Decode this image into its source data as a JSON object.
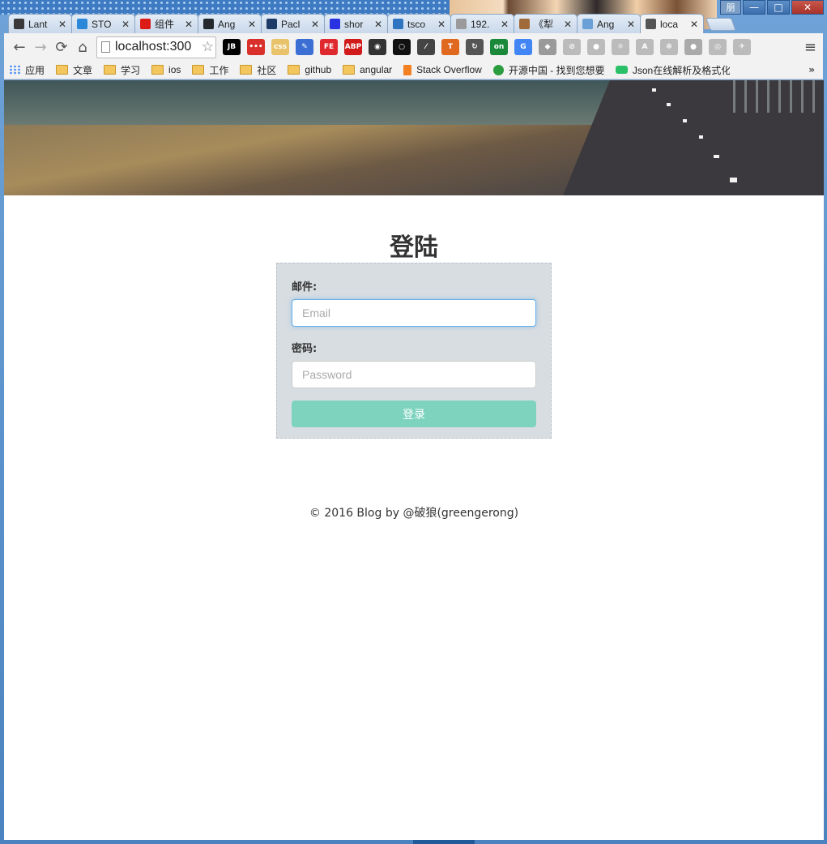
{
  "browser": {
    "window_controls": {
      "user": "朋",
      "minimize": "—",
      "maximize": "□",
      "close": "✕"
    },
    "tabs": [
      {
        "label": "Lant",
        "icon": "arrow-up-icon",
        "color": "#3a3a3a"
      },
      {
        "label": "STO",
        "icon": "globe-icon",
        "color": "#2b88d9"
      },
      {
        "label": "组件",
        "icon": "angular-icon",
        "color": "#dd1b16"
      },
      {
        "label": "Ang",
        "icon": "github-icon",
        "color": "#24292e"
      },
      {
        "label": "Pacl",
        "icon": "n-icon",
        "color": "#1d3b66"
      },
      {
        "label": "shor",
        "icon": "paw-icon",
        "color": "#2932e1"
      },
      {
        "label": "tsco",
        "icon": "ts-icon",
        "color": "#2f74c0"
      },
      {
        "label": "192.",
        "icon": "page-icon",
        "color": "#9a9a9a"
      },
      {
        "label": "《犁",
        "icon": "image-icon",
        "color": "#a06a3a"
      },
      {
        "label": "Ang",
        "icon": "puzzle-icon",
        "color": "#6aa0d6"
      },
      {
        "label": "loca",
        "icon": "bird-icon",
        "color": "#555555",
        "active": true
      }
    ],
    "toolbar": {
      "back": "←",
      "forward": "→",
      "reload": "⟳",
      "home": "⌂",
      "url": "localhost:300",
      "star": "☆",
      "menu": "≡",
      "extensions": [
        {
          "name": "jetbrains-icon",
          "text": "JB",
          "color": "#000000"
        },
        {
          "name": "dots-icon",
          "text": "•••",
          "color": "#d9302c"
        },
        {
          "name": "css-icon",
          "text": "css",
          "color": "#e8c36b"
        },
        {
          "name": "edit-icon",
          "text": "✎",
          "color": "#3b6fd4"
        },
        {
          "name": "fe-icon",
          "text": "FE",
          "color": "#e0292e"
        },
        {
          "name": "adblock-icon",
          "text": "ABP",
          "color": "#d11a1a"
        },
        {
          "name": "camera-icon",
          "text": "◉",
          "color": "#333333"
        },
        {
          "name": "ring-icon",
          "text": "○",
          "color": "#111111"
        },
        {
          "name": "eyedropper-icon",
          "text": "⁄",
          "color": "#444444"
        },
        {
          "name": "t-icon",
          "text": "T",
          "color": "#e0681f"
        },
        {
          "name": "refresh-ext-icon",
          "text": "↻",
          "color": "#555555"
        },
        {
          "name": "on-icon",
          "text": "on",
          "color": "#1a8a3a"
        },
        {
          "name": "translate-icon",
          "text": "G",
          "color": "#4285f4"
        },
        {
          "name": "diamond-icon",
          "text": "◆",
          "color": "#9a9a9a"
        },
        {
          "name": "feather-icon",
          "text": "⊘",
          "color": "#bbbbbb"
        },
        {
          "name": "sphere-icon",
          "text": "●",
          "color": "#bbbbbb"
        },
        {
          "name": "react-icon",
          "text": "⚛",
          "color": "#bbbbbb"
        },
        {
          "name": "angular-ext-icon",
          "text": "A",
          "color": "#bbbbbb"
        },
        {
          "name": "atom-icon",
          "text": "✻",
          "color": "#bbbbbb"
        },
        {
          "name": "dot-icon",
          "text": "●",
          "color": "#aaaaaa"
        },
        {
          "name": "target-icon",
          "text": "◎",
          "color": "#bbbbbb"
        },
        {
          "name": "bird-ext-icon",
          "text": "✈",
          "color": "#bbbbbb"
        }
      ]
    },
    "bookmarks": [
      {
        "label": "应用",
        "icon": "apps-icon"
      },
      {
        "label": "文章",
        "icon": "folder-icon"
      },
      {
        "label": "学习",
        "icon": "folder-icon"
      },
      {
        "label": "ios",
        "icon": "folder-icon"
      },
      {
        "label": "工作",
        "icon": "folder-icon"
      },
      {
        "label": "社区",
        "icon": "folder-icon"
      },
      {
        "label": "github",
        "icon": "folder-icon"
      },
      {
        "label": "angular",
        "icon": "folder-icon"
      },
      {
        "label": "Stack Overflow",
        "icon": "stackoverflow-icon"
      },
      {
        "label": "开源中国 - 找到您想要",
        "icon": "oschina-icon"
      },
      {
        "label": "Json在线解析及格式化",
        "icon": "json-icon"
      }
    ],
    "bookmarks_more": "»"
  },
  "page": {
    "title": "登陆",
    "form": {
      "email_label": "邮件:",
      "email_placeholder": "Email",
      "password_label": "密码:",
      "password_placeholder": "Password",
      "submit_label": "登录"
    },
    "footer": "© 2016 Blog by @破狼(greengerong)"
  },
  "colors": {
    "accent_button": "#7dd3be",
    "panel_bg": "#d8dde1",
    "focus_border": "#66afe9"
  }
}
